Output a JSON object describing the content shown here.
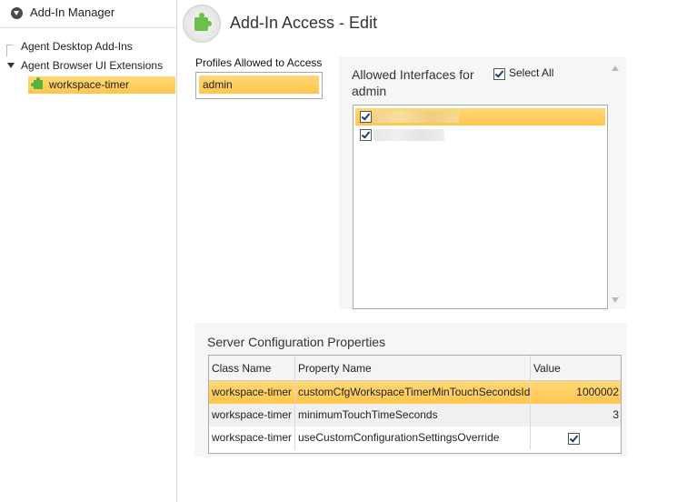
{
  "sidebar": {
    "title": "Add-In Manager",
    "items": [
      {
        "label": "Agent Desktop Add-Ins"
      },
      {
        "label": "Agent Browser UI Extensions"
      },
      {
        "label": "workspace-timer"
      }
    ]
  },
  "header": {
    "title": "Add-In Access - Edit"
  },
  "profiles": {
    "label": "Profiles Allowed to Access",
    "items": [
      "admin"
    ]
  },
  "interfaces": {
    "title": "Allowed Interfaces for",
    "profile": "admin",
    "select_all_label": "Select All",
    "select_all_checked": true,
    "items": [
      {
        "checked": true,
        "selected": true
      },
      {
        "checked": true,
        "selected": false
      }
    ]
  },
  "server_config": {
    "title": "Server Configuration Properties",
    "columns": [
      "Class Name",
      "Property Name",
      "Value"
    ],
    "rows": [
      {
        "class_name": "workspace-timer",
        "property": "customCfgWorkspaceTimerMinTouchSecondsId",
        "value": "1000002"
      },
      {
        "class_name": "workspace-timer",
        "property": "minimumTouchTimeSeconds",
        "value": "3"
      },
      {
        "class_name": "workspace-timer",
        "property": "useCustomConfigurationSettingsOverride",
        "value": "",
        "checked": true
      }
    ]
  },
  "colors": {
    "selection": "#ffc64d",
    "panel_bg": "#f6f6f6",
    "accent_green": "#6cc04a"
  },
  "icons": {
    "header_icon": "chevron-circle-down-icon",
    "addin_icon": "puzzle-piece-icon"
  }
}
